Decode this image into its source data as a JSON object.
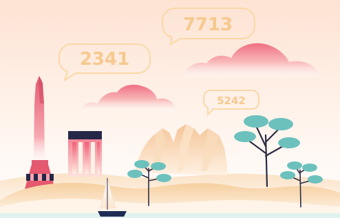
{
  "bubbles": [
    {
      "value": "7713"
    },
    {
      "value": "2341"
    },
    {
      "value": "5242"
    }
  ],
  "colors": {
    "sky_top": "#fde6d6",
    "sky_bottom": "#ffffff",
    "cloud_top": "#f07a8c",
    "cloud_bottom": "#ffffff",
    "bubble_stroke": "#fbd7a7",
    "bubble_text": "#f6c98e",
    "tree_leaf": "#6cc1bd",
    "trunk": "#2d2b43",
    "tower": "#e35a73",
    "building_roof": "#262748",
    "hill": "#f7d2a6",
    "rock": "#f2c495",
    "boat_hull": "#1f2d55"
  }
}
